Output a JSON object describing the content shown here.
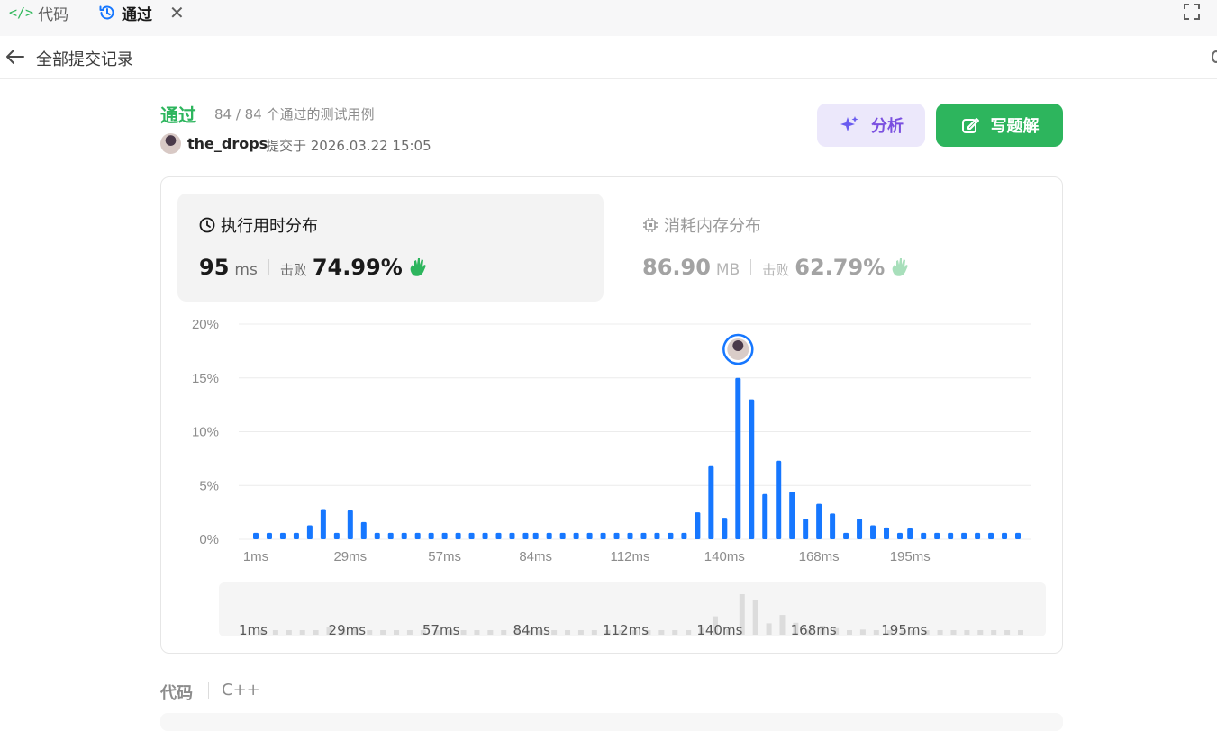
{
  "tabs": {
    "code_label": "代码",
    "accepted_label": "通过"
  },
  "header": {
    "title": "全部提交记录"
  },
  "submission": {
    "status": "通过",
    "cases": "84 / 84 个通过的测试用例",
    "username": "the_drops",
    "submitted_at": "提交于 2026.03.22 15:05"
  },
  "actions": {
    "analyze_label": "分析",
    "write_solution_label": "写题解"
  },
  "runtime": {
    "title": "执行用时分布",
    "value": "95",
    "unit": "ms",
    "beats_label": "击败",
    "beats_pct": "74.99%"
  },
  "memory": {
    "title": "消耗内存分布",
    "value": "86.90",
    "unit": "MB",
    "beats_label": "击败",
    "beats_pct": "62.79%"
  },
  "code_section": {
    "label": "代码",
    "language": "C++"
  },
  "colors": {
    "accent_green": "#2db55d",
    "bar_blue": "#1677ff",
    "analyze_purple": "#7a4fe0"
  },
  "chart_data": {
    "type": "bar",
    "yticks": [
      "20%",
      "15%",
      "10%",
      "5%",
      "0%"
    ],
    "ylim": [
      0,
      20
    ],
    "xticks": [
      "1ms",
      "29ms",
      "57ms",
      "84ms",
      "112ms",
      "140ms",
      "168ms",
      "195ms"
    ],
    "x": [
      1,
      5,
      9,
      13,
      17,
      21,
      25,
      29,
      33,
      37,
      41,
      45,
      49,
      53,
      57,
      61,
      65,
      69,
      73,
      77,
      81,
      84,
      88,
      92,
      96,
      100,
      104,
      108,
      112,
      116,
      120,
      124,
      128,
      132,
      136,
      140,
      144,
      148,
      152,
      156,
      160,
      164,
      168,
      172,
      176,
      180,
      184,
      188,
      192,
      195,
      199,
      203,
      207,
      211,
      215,
      219,
      223,
      227
    ],
    "values": [
      0.6,
      0.6,
      0.6,
      0.6,
      1.3,
      2.8,
      0.6,
      2.7,
      1.6,
      0.6,
      0.6,
      0.6,
      0.6,
      0.6,
      0.6,
      0.6,
      0.6,
      0.6,
      0.6,
      0.6,
      0.6,
      0.6,
      0.6,
      0.6,
      0.6,
      0.6,
      0.6,
      0.6,
      0.6,
      0.6,
      0.6,
      0.6,
      0.6,
      2.5,
      6.8,
      2.0,
      15.0,
      13.0,
      4.2,
      7.3,
      4.4,
      1.9,
      3.3,
      2.4,
      0.6,
      1.9,
      1.3,
      1.1,
      0.6,
      1.0,
      0.6,
      0.6,
      0.6,
      0.6,
      0.6,
      0.6,
      0.6,
      0.6
    ],
    "highlight_index": 36,
    "grid": true
  }
}
